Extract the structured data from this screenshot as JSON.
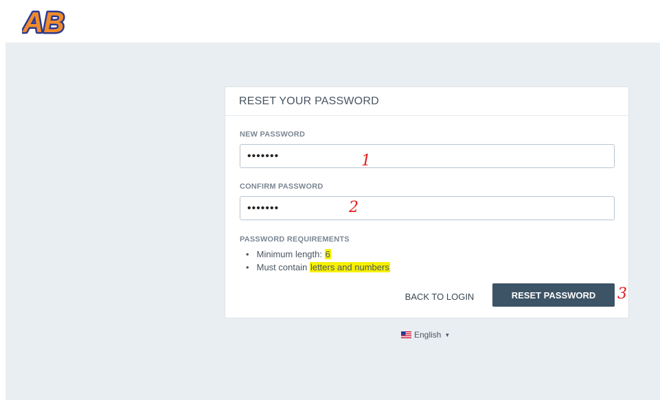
{
  "logo": {
    "text": "AB",
    "colors": {
      "letters": "#f08b2c",
      "outline": "#2b3990"
    }
  },
  "card": {
    "title": "RESET YOUR PASSWORD",
    "new_password": {
      "label": "NEW PASSWORD",
      "value": "•••••••"
    },
    "confirm_password": {
      "label": "CONFIRM PASSWORD",
      "value": "•••••••"
    },
    "requirements": {
      "label": "PASSWORD REQUIREMENTS",
      "items": [
        {
          "prefix": "Minimum length: ",
          "highlight": "6"
        },
        {
          "prefix": "Must contain ",
          "highlight": "letters and numbers"
        }
      ]
    },
    "back_label": "BACK TO LOGIN",
    "reset_label": "RESET PASSWORD"
  },
  "language": {
    "label": "English",
    "flag": "us-flag-icon"
  },
  "annotations": {
    "step1": "1",
    "step2": "2",
    "step3": "3"
  },
  "colors": {
    "background": "#e9eef2",
    "button": "#3d5366",
    "highlight": "#f6f000",
    "annotation": "#e41b1b"
  }
}
